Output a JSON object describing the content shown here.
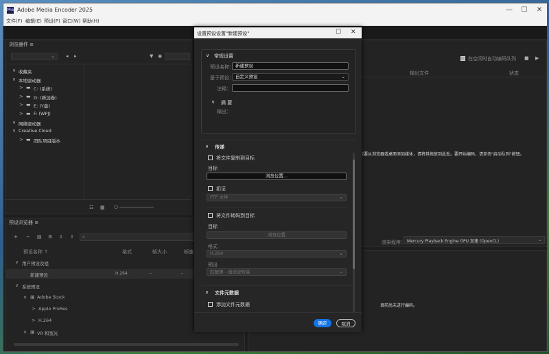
{
  "app": {
    "title": "Adobe Media Encoder 2025",
    "logo": "Me",
    "window_controls": [
      "—",
      "☐",
      "✕"
    ]
  },
  "menu": [
    "文件(F)",
    "编辑(E)",
    "预设(P)",
    "窗口(W)",
    "帮助(H)"
  ],
  "browser_panel": {
    "title": "浏览器件 ≡",
    "tree": [
      {
        "label": "收藏夹",
        "indent": 0,
        "arrow": "∨"
      },
      {
        "label": "本地驱动器",
        "indent": 0,
        "arrow": "∨"
      },
      {
        "label": "C: (系统)",
        "indent": 1,
        "arrow": ">"
      },
      {
        "label": "D: (新加卷)",
        "indent": 1,
        "arrow": ">"
      },
      {
        "label": "E: (Y盘)",
        "indent": 1,
        "arrow": ">"
      },
      {
        "label": "F: (WPJ)",
        "indent": 1,
        "arrow": ">"
      },
      {
        "label": "网络驱动器",
        "indent": 0,
        "arrow": "∨"
      },
      {
        "label": "Creative Cloud",
        "indent": 0,
        "arrow": "∨"
      },
      {
        "label": "团队项目版本",
        "indent": 1,
        "arrow": ">"
      }
    ]
  },
  "preset_panel": {
    "title": "预设浏览器 ≡",
    "search_placeholder": "",
    "columns": [
      "预设名称 ↑",
      "格式",
      "帧大小",
      "帧速"
    ],
    "rows": [
      {
        "label": "用户预设及组",
        "indent": 0,
        "arrow": "∨",
        "format": "",
        "size": "",
        "rate": ""
      },
      {
        "label": "新建预设",
        "indent": 1,
        "arrow": "",
        "format": "H.264",
        "size": "–",
        "rate": "–"
      },
      {
        "label": "系统预设",
        "indent": 0,
        "arrow": "∨",
        "format": "",
        "size": "",
        "rate": ""
      },
      {
        "label": "Adobe Stock",
        "indent": 1,
        "arrow": "∨",
        "format": "",
        "size": "",
        "rate": ""
      },
      {
        "label": "Apple ProRes",
        "indent": 2,
        "arrow": ">",
        "format": "",
        "size": "",
        "rate": ""
      },
      {
        "label": "H.264",
        "indent": 2,
        "arrow": ">",
        "format": "",
        "size": "",
        "rate": ""
      },
      {
        "label": "VR 和宽光",
        "indent": 1,
        "arrow": "∨",
        "format": "",
        "size": "",
        "rate": ""
      }
    ]
  },
  "queue_panel": {
    "auto_encode_label": "在空闲时自动编码队列",
    "col_output": "输出文件",
    "col_status": "状态",
    "hint": "若要从浏览器或桌面添加媒体，请将其拖放到此处。要开始编码，请单击\"启动队列\"按钮。",
    "renderer_label": "渲染程序：",
    "renderer_value": "Mercury Playback Engine GPU 加速 (OpenCL)"
  },
  "encoding_panel": {
    "status": "目前尚未进行编码。"
  },
  "dialog": {
    "title": "设置预设设置\"新建预设\"",
    "basic_section": "常规设置",
    "preset_name_label": "预设名称：",
    "preset_name_value": "新建预设",
    "based_on_label": "基于预设：",
    "based_on_value": "自定义预设",
    "comment_label": "注释：",
    "comment_value": "",
    "summary_section": "摘 要",
    "output_label": "输出：",
    "publish_section": "传递",
    "copy_to_dest_label": "将文件复制到目标",
    "dest_label": "目标",
    "browse_label": "浏览位置...",
    "ingest_label": "扣证",
    "ingest_value": "FTP 文件",
    "transcode_label": "将文件转码到目标",
    "dest2_label": "目标",
    "browse2_label": "浏览位置",
    "format_label": "格式",
    "format_value": "H.264",
    "preset_label": "预设",
    "preset_value": "匹配源 - 自适应较高",
    "metadata_section": "文件元数据",
    "add_metadata_label": "添加文件元数据",
    "ok_label": "确定",
    "cancel_label": "取消"
  },
  "colors": {
    "accent": "#1473e6"
  }
}
